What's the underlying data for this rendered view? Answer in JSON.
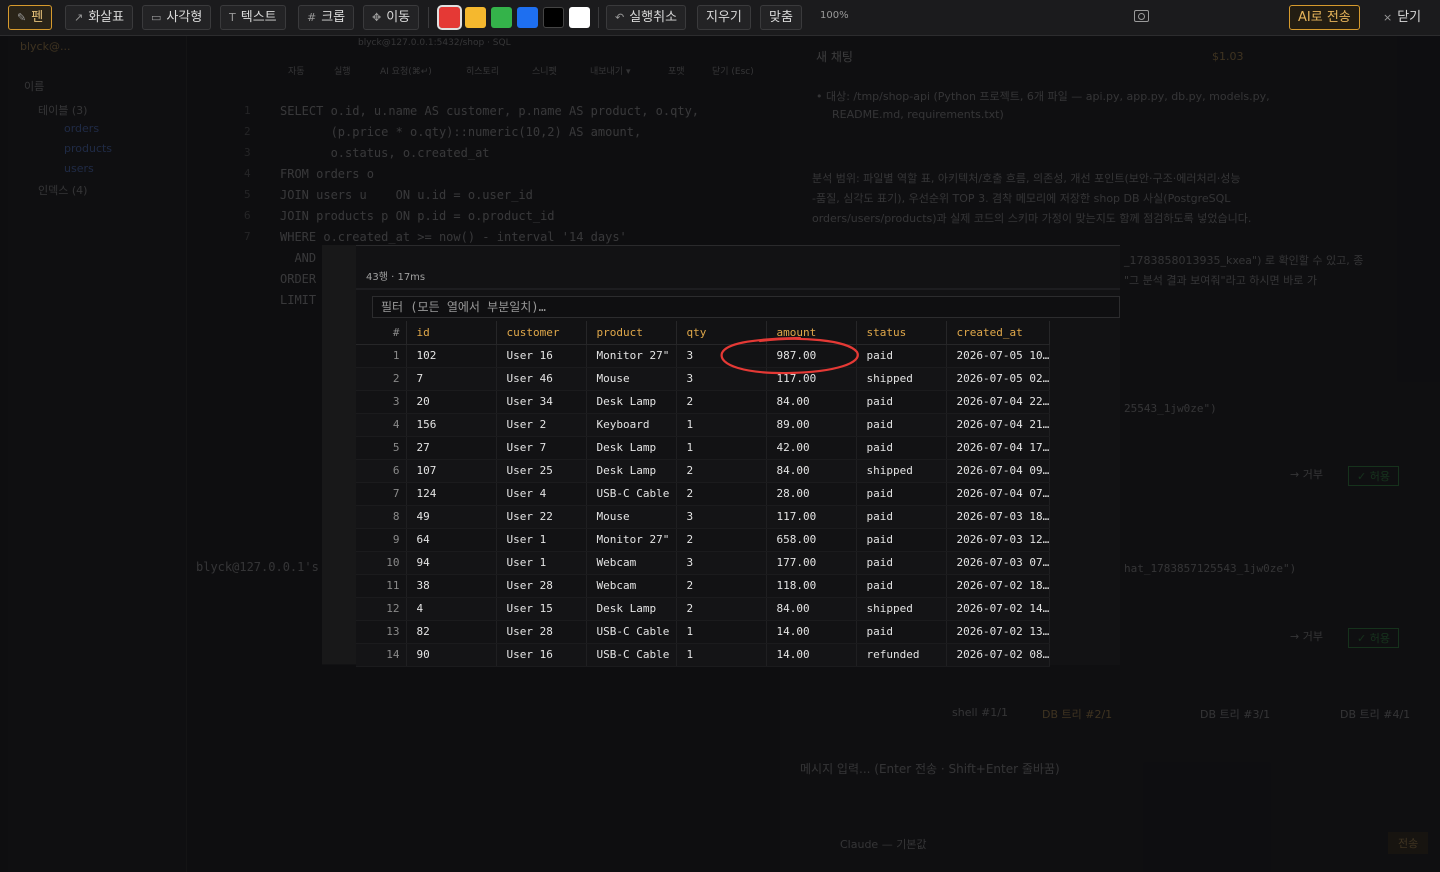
{
  "toolbar": {
    "pen": "펜",
    "arrow": "화살표",
    "rect": "사각형",
    "text": "텍스트",
    "crop": "크롭",
    "move": "이동",
    "undo": "실행취소",
    "erase": "지우기",
    "fit": "맞춤",
    "zoom": "100%",
    "send_ai": "AI로 전송",
    "close": "닫기",
    "colors": [
      "#e53935",
      "#f5b82e",
      "#34b34a",
      "#1e6ff0",
      "#000000",
      "#ffffff"
    ],
    "selected_color": "#e53935",
    "icons": {
      "pen": "pen-icon",
      "arrow": "arrow-icon",
      "rect": "rect-icon",
      "text": "text-icon",
      "crop": "crop-icon",
      "move": "move-icon",
      "undo": "undo-icon",
      "camera": "camera-icon",
      "close": "close-icon"
    }
  },
  "background": {
    "sidebar": {
      "header": "blyck@...",
      "filter_label": "이름",
      "items": [
        "테이블 (3)",
        "orders",
        "products",
        "users",
        "인덱스 (4)"
      ]
    },
    "editor": {
      "tab": "blyck@127.0.0.1:5432/shop · SQL",
      "toolbar": [
        "자동",
        "실행",
        "AI 요청(⌘↵)",
        "히스토리",
        "스니펫",
        "내보내기 ▾",
        "포맷",
        "닫기 (Esc)"
      ],
      "lines": [
        "SELECT o.id, u.name AS customer, p.name AS product, o.qty,",
        "       (p.price * o.qty)::numeric(10,2) AS amount,",
        "       o.status, o.created_at",
        "FROM orders o",
        "JOIN users u    ON u.id = o.user_id",
        "JOIN products p ON p.id = o.product_id",
        "WHERE o.created_at >= now() - interval '14 days'",
        "  AND",
        "ORDER",
        "LIMIT"
      ],
      "terminal_prompt": "blyck@127.0.0.1's"
    },
    "chat": {
      "title": "새 채팅",
      "cost": "$1.03",
      "p1": "• 대상: /tmp/shop-api (Python 프로젝트, 6개 파일 — api.py, app.py, db.py, models.py,",
      "p1b": "README.md, requirements.txt)",
      "p2": "분석 범위: 파일별 역할 표, 아키텍처/호출 흐름, 의존성, 개선 포인트(보안·구조·에러처리·성능",
      "p2b": "-품질, 심각도 표기), 우선순위 TOP 3. 겸착 메모리에 저장한 shop DB 사실(PostgreSQL",
      "p2c": "orders/users/products)과 실제 코드의 스키마 가정이 맞는지도 함께 점검하도록 넣었습니다.",
      "p3": "_1783858013935_kxea\") 로 확인할 수 있고, 종",
      "p3b": "\"그 분석 결과 보여줘\"라고 하시면 바로 가",
      "ref1": "25543_1jw0ze\")",
      "ref2": "hat_1783857125543_1jw0ze\")",
      "approve": "✓ 허용",
      "deny": "→ 거부",
      "chips": [
        "shell #1/1",
        "DB 트리 #2/1",
        "DB 트리 #3/1",
        "DB 트리 #4/1"
      ],
      "input_placeholder": "메시지 입력... (Enter 전송 · Shift+Enter 줄바꿈)",
      "model": "Claude — 기본값",
      "send": "전송"
    }
  },
  "results": {
    "meta": "43행 · 17ms",
    "filter_placeholder": "필터 (모든 열에서 부분일치)…",
    "columns": [
      "#",
      "id",
      "customer",
      "product",
      "qty",
      "amount",
      "status",
      "created_at"
    ],
    "rows": [
      [
        "1",
        "102",
        "User 16",
        "Monitor 27\"",
        "3",
        "987.00",
        "paid",
        "2026-07-05 10…"
      ],
      [
        "2",
        "7",
        "User 46",
        "Mouse",
        "3",
        "117.00",
        "shipped",
        "2026-07-05 02…"
      ],
      [
        "3",
        "20",
        "User 34",
        "Desk Lamp",
        "2",
        "84.00",
        "paid",
        "2026-07-04 22…"
      ],
      [
        "4",
        "156",
        "User 2",
        "Keyboard",
        "1",
        "89.00",
        "paid",
        "2026-07-04 21…"
      ],
      [
        "5",
        "27",
        "User 7",
        "Desk Lamp",
        "1",
        "42.00",
        "paid",
        "2026-07-04 17…"
      ],
      [
        "6",
        "107",
        "User 25",
        "Desk Lamp",
        "2",
        "84.00",
        "shipped",
        "2026-07-04 09…"
      ],
      [
        "7",
        "124",
        "User 4",
        "USB-C Cable",
        "2",
        "28.00",
        "paid",
        "2026-07-04 07…"
      ],
      [
        "8",
        "49",
        "User 22",
        "Mouse",
        "3",
        "117.00",
        "paid",
        "2026-07-03 18…"
      ],
      [
        "9",
        "64",
        "User 1",
        "Monitor 27\"",
        "2",
        "658.00",
        "paid",
        "2026-07-03 12…"
      ],
      [
        "10",
        "94",
        "User 1",
        "Webcam",
        "3",
        "177.00",
        "paid",
        "2026-07-03 07…"
      ],
      [
        "11",
        "38",
        "User 28",
        "Webcam",
        "2",
        "118.00",
        "paid",
        "2026-07-02 18…"
      ],
      [
        "12",
        "4",
        "User 15",
        "Desk Lamp",
        "2",
        "84.00",
        "shipped",
        "2026-07-02 14…"
      ],
      [
        "13",
        "82",
        "User 28",
        "USB-C Cable",
        "1",
        "14.00",
        "paid",
        "2026-07-02 13…"
      ],
      [
        "14",
        "90",
        "User 16",
        "USB-C Cable",
        "1",
        "14.00",
        "refunded",
        "2026-07-02 08…"
      ]
    ]
  },
  "annotation": {
    "shape": "ellipse",
    "color": "#e53935",
    "target": "amount 987.00"
  }
}
